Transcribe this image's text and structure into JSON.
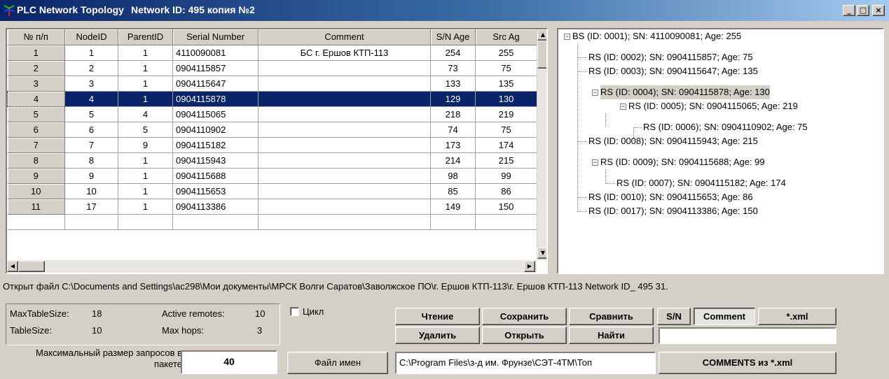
{
  "window": {
    "title": "PLC Network Topology",
    "network_label": "Network ID: 495 копия №2",
    "minimize": "_",
    "maximize": "□",
    "close": "×"
  },
  "grid": {
    "columns": [
      "№ п/п",
      "NodeID",
      "ParentID",
      "Serial Number",
      "Comment",
      "S/N Age",
      "Src Ag"
    ],
    "rows": [
      {
        "n": "1",
        "node": "1",
        "parent": "1",
        "serial": "4110090081",
        "comment": "БС г. Ершов КТП-113",
        "snage": "254",
        "srcage": "255"
      },
      {
        "n": "2",
        "node": "2",
        "parent": "1",
        "serial": "0904115857",
        "comment": "",
        "snage": "73",
        "srcage": "75"
      },
      {
        "n": "3",
        "node": "3",
        "parent": "1",
        "serial": "0904115647",
        "comment": "",
        "snage": "133",
        "srcage": "135"
      },
      {
        "n": "4",
        "node": "4",
        "parent": "1",
        "serial": "0904115878",
        "comment": "",
        "snage": "129",
        "srcage": "130"
      },
      {
        "n": "5",
        "node": "5",
        "parent": "4",
        "serial": "0904115065",
        "comment": "",
        "snage": "218",
        "srcage": "219"
      },
      {
        "n": "6",
        "node": "6",
        "parent": "5",
        "serial": "0904110902",
        "comment": "",
        "snage": "74",
        "srcage": "75"
      },
      {
        "n": "7",
        "node": "7",
        "parent": "9",
        "serial": "0904115182",
        "comment": "",
        "snage": "173",
        "srcage": "174"
      },
      {
        "n": "8",
        "node": "8",
        "parent": "1",
        "serial": "0904115943",
        "comment": "",
        "snage": "214",
        "srcage": "215"
      },
      {
        "n": "9",
        "node": "9",
        "parent": "1",
        "serial": "0904115688",
        "comment": "",
        "snage": "98",
        "srcage": "99"
      },
      {
        "n": "10",
        "node": "10",
        "parent": "1",
        "serial": "0904115653",
        "comment": "",
        "snage": "85",
        "srcage": "86"
      },
      {
        "n": "11",
        "node": "17",
        "parent": "1",
        "serial": "0904113386",
        "comment": "",
        "snage": "149",
        "srcage": "150"
      }
    ],
    "selected_row": 3
  },
  "tree": [
    "BS (ID: 0001); SN: 4110090081; Age: 255",
    "RS (ID: 0002); SN: 0904115857; Age: 75",
    "RS (ID: 0003); SN: 0904115647; Age: 135",
    "RS (ID: 0004); SN: 0904115878; Age: 130",
    "RS (ID: 0005); SN: 0904115065; Age: 219",
    "RS (ID: 0006); SN: 0904110902; Age: 75",
    "RS (ID: 0008); SN: 0904115943; Age: 215",
    "RS (ID: 0009); SN: 0904115688; Age: 99",
    "RS (ID: 0007); SN: 0904115182; Age: 174",
    "RS (ID: 0010); SN: 0904115653; Age: 86",
    "RS (ID: 0017); SN: 0904113386; Age: 150"
  ],
  "status": {
    "file_line": "Открыт файл C:\\Documents and Settings\\ac298\\Мои документы\\МРСК Волги Саратов\\Заволжское ПО\\г. Ершов КТП-113\\г. Ершов КТП-113   Network ID_ 495 31."
  },
  "stats": {
    "max_table_size_label": "MaxTableSize:",
    "max_table_size": "18",
    "table_size_label": "TableSize:",
    "table_size": "10",
    "active_remotes_label": "Active remotes:",
    "active_remotes": "10",
    "max_hops_label": "Max hops:",
    "max_hops": "3",
    "max_request_label": "Максимальный размер запросов в пакете",
    "max_request_value": "40"
  },
  "controls": {
    "cycle_label": "Цикл",
    "read": "Чтение",
    "save": "Сохранить",
    "compare": "Сравнить",
    "sn": "S/N",
    "comment": "Comment",
    "xml": "*.xml",
    "delete": "Удалить",
    "open": "Открыть",
    "find": "Найти",
    "names_file": "Файл имен",
    "path_value": "C:\\Program Files\\з-д им. Фрунзе\\СЭТ-4ТМ\\Топ",
    "comments_from_xml": "COMMENTS из *.xml",
    "find_field_value": ""
  },
  "colors": {
    "title_start": "#0a246a",
    "title_end": "#a6caf0",
    "selection": "#0a246a",
    "face": "#d4d0c8"
  }
}
